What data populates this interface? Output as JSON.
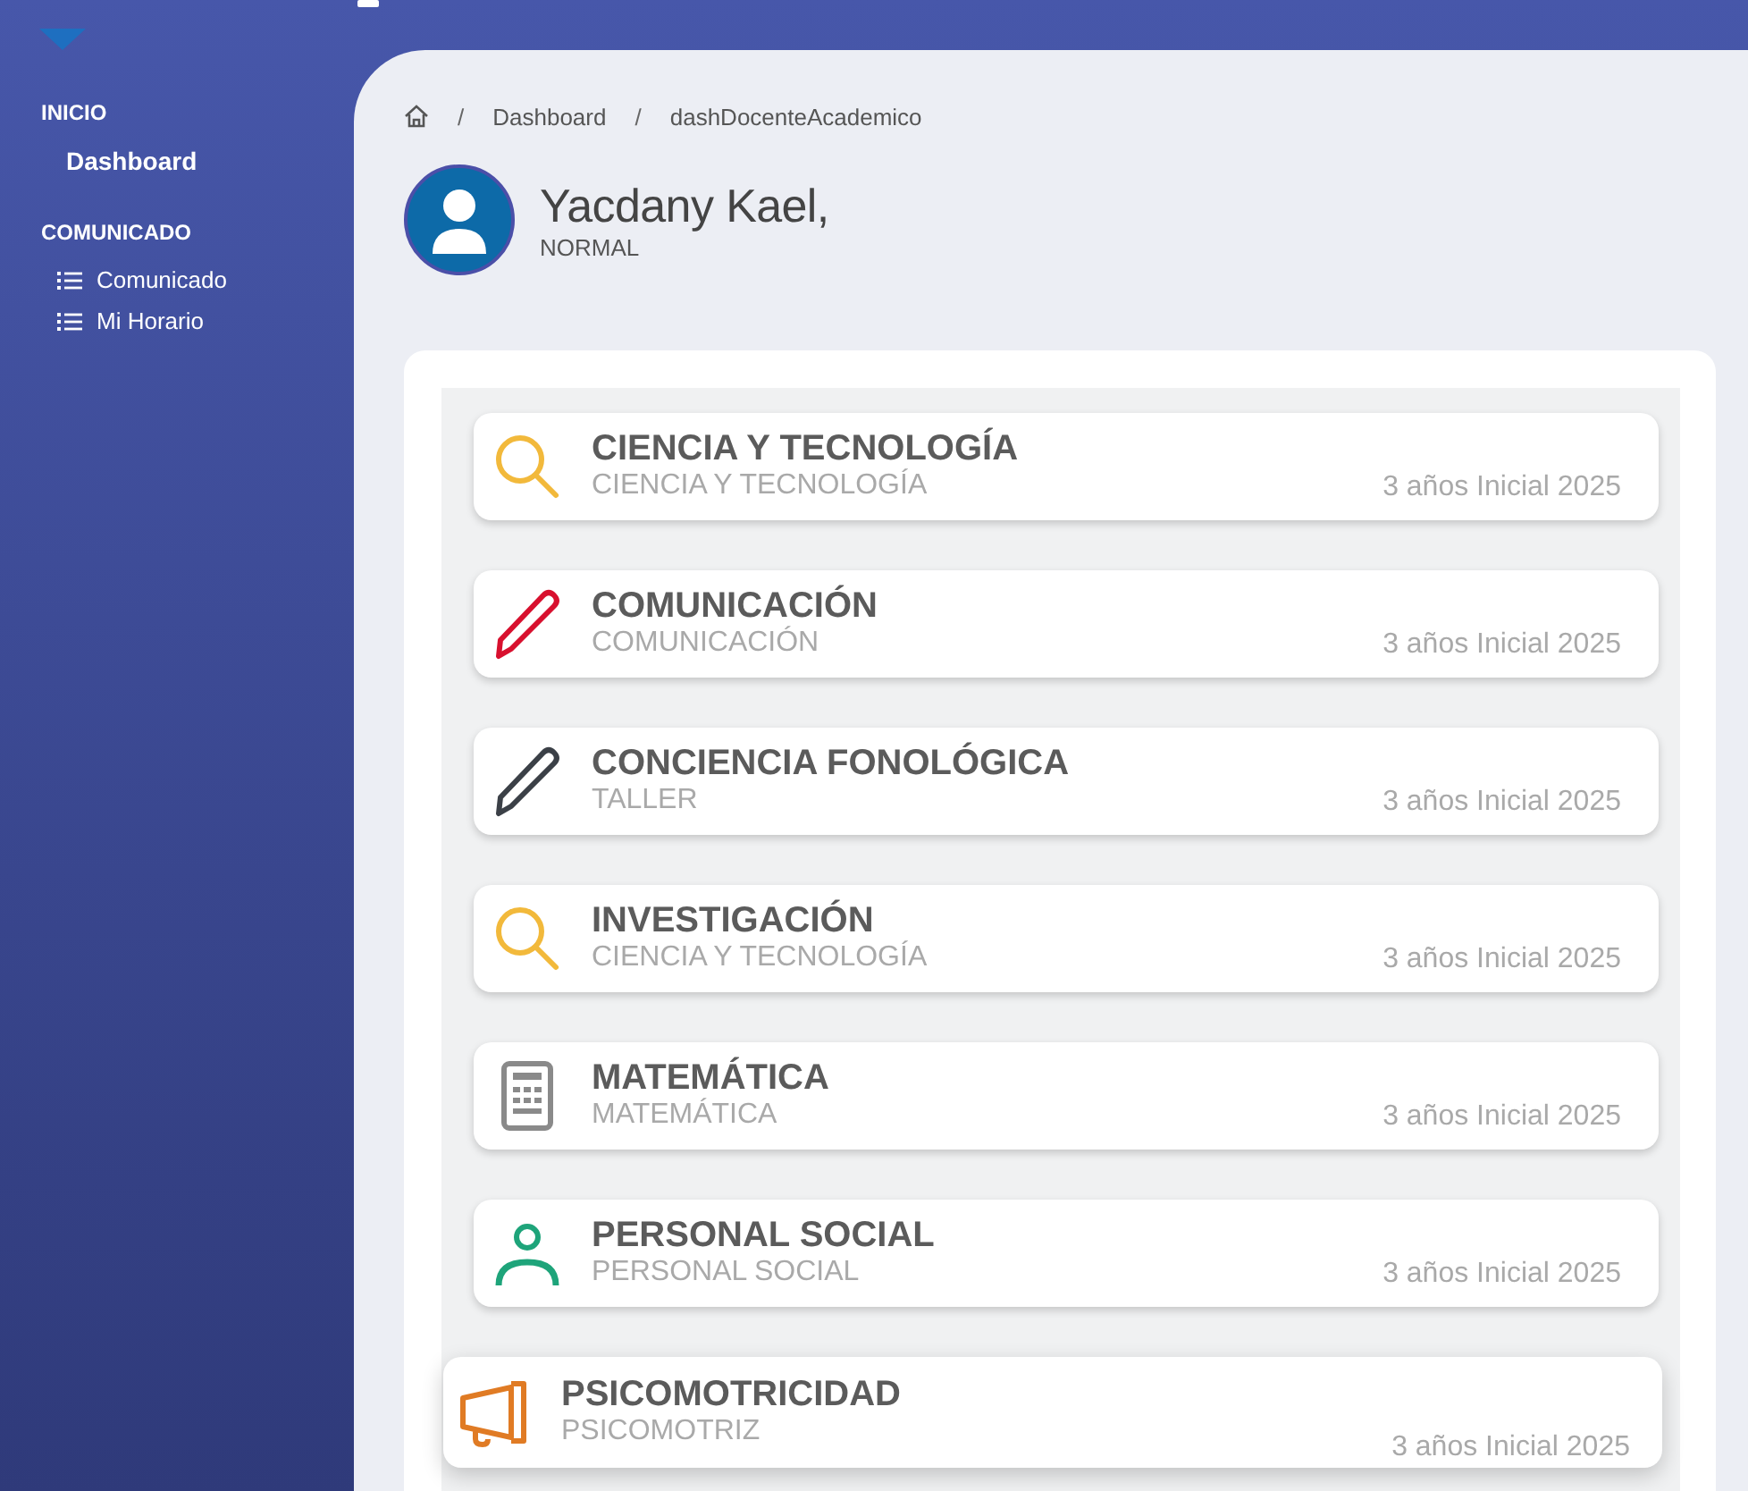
{
  "sidebar": {
    "sections": [
      {
        "title": "INICIO",
        "items": [
          {
            "label": "Dashboard",
            "kind": "plain",
            "selected": true
          }
        ]
      },
      {
        "title": "COMUNICADO",
        "items": [
          {
            "label": "Comunicado",
            "kind": "list",
            "selected": false
          },
          {
            "label": "Mi Horario",
            "kind": "list",
            "selected": false
          }
        ]
      }
    ]
  },
  "breadcrumb": [
    {
      "separator": "/",
      "label": "Dashboard"
    },
    {
      "separator": "/",
      "label": "dashDocenteAcademico"
    }
  ],
  "profile": {
    "name": "Yacdany Kael,",
    "role": "NORMAL"
  },
  "courses": [
    {
      "title": "CIENCIA Y TECNOLOGÍA",
      "subtitle": "CIENCIA Y TECNOLOGÍA",
      "meta": "3 años Inicial 2025",
      "kind": "search",
      "color": "#f2b93b",
      "hovered": false
    },
    {
      "title": "COMUNICACIÓN",
      "subtitle": "COMUNICACIÓN",
      "meta": "3 años Inicial 2025",
      "kind": "pencil",
      "color": "#d8102e",
      "hovered": false
    },
    {
      "title": "CONCIENCIA FONOLÓGICA",
      "subtitle": "TALLER",
      "meta": "3 años Inicial 2025",
      "kind": "pencil",
      "color": "#3b4047",
      "hovered": false
    },
    {
      "title": "INVESTIGACIÓN",
      "subtitle": "CIENCIA Y TECNOLOGÍA",
      "meta": "3 años Inicial 2025",
      "kind": "search",
      "color": "#f2b93b",
      "hovered": false
    },
    {
      "title": "MATEMÁTICA",
      "subtitle": "MATEMÁTICA",
      "meta": "3 años Inicial 2025",
      "kind": "calculator",
      "color": "#8a8a8a",
      "hovered": false
    },
    {
      "title": "PERSONAL SOCIAL",
      "subtitle": "PERSONAL SOCIAL",
      "meta": "3 años Inicial 2025",
      "kind": "user",
      "color": "#1ea47a",
      "hovered": false
    },
    {
      "title": "PSICOMOTRICIDAD",
      "subtitle": "PSICOMOTRIZ",
      "meta": "3 años Inicial 2025",
      "kind": "megaphone",
      "color": "#e07b24",
      "hovered": true
    }
  ]
}
